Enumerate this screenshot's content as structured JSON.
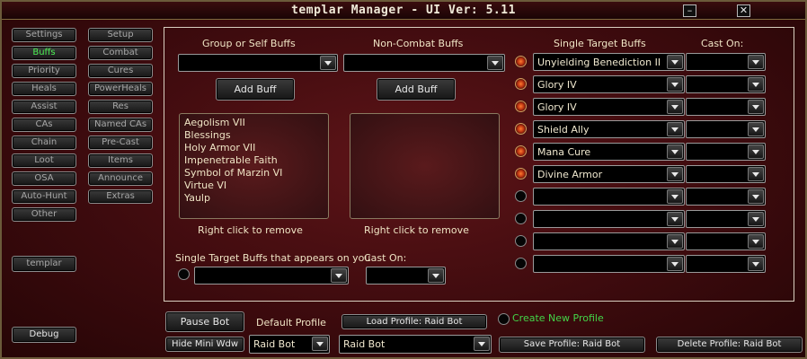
{
  "window": {
    "title": "templar Manager   - UI Ver: 5.11",
    "minimize": "–",
    "close": "✕"
  },
  "sidebar": {
    "left": [
      "Settings",
      "Buffs",
      "Priority",
      "Heals",
      "Assist",
      "CAs",
      "Chain",
      "Loot",
      "OSA",
      "Auto-Hunt",
      "Other"
    ],
    "right": [
      "Setup",
      "Combat",
      "Cures",
      "PowerHeals",
      "Res",
      "Named CAs",
      "Pre-Cast",
      "Items",
      "Announce",
      "Extras"
    ],
    "active": "Buffs",
    "profile_button": "templar",
    "debug_button": "Debug"
  },
  "group_buffs": {
    "label": "Group or Self Buffs",
    "add_button": "Add Buff",
    "items": [
      "Aegolism VII",
      "Blessings",
      "Holy Armor VII",
      "Impenetrable Faith",
      "Symbol of Marzin VI",
      "Virtue VI",
      "Yaulp"
    ],
    "remove_hint": "Right click to remove"
  },
  "noncombat_buffs": {
    "label": "Non-Combat Buffs",
    "add_button": "Add Buff",
    "items": [],
    "remove_hint": "Right click to remove"
  },
  "single_target": {
    "label": "Single Target Buffs",
    "cast_on_label": "Cast On:",
    "rows": [
      {
        "buff": "Unyielding Benediction II",
        "cast_on": "",
        "enabled": true
      },
      {
        "buff": "Glory IV",
        "cast_on": "",
        "enabled": true
      },
      {
        "buff": "Glory IV",
        "cast_on": "",
        "enabled": true
      },
      {
        "buff": "Shield Ally",
        "cast_on": "",
        "enabled": true
      },
      {
        "buff": "Mana Cure",
        "cast_on": "",
        "enabled": true
      },
      {
        "buff": "Divine Armor",
        "cast_on": "",
        "enabled": true
      },
      {
        "buff": "",
        "cast_on": "",
        "enabled": false
      },
      {
        "buff": "",
        "cast_on": "",
        "enabled": false
      },
      {
        "buff": "",
        "cast_on": "",
        "enabled": false
      },
      {
        "buff": "",
        "cast_on": "",
        "enabled": false
      }
    ]
  },
  "appears_on_you": {
    "label": "Single Target Buffs that appears on you",
    "value": "",
    "cast_on_label": "Cast On:",
    "cast_on_value": ""
  },
  "footer": {
    "pause_button": "Pause Bot",
    "hide_button": "Hide Mini Wdw",
    "default_profile_label": "Default Profile",
    "default_profile_value": "Raid Bot",
    "load_button": "Load Profile: Raid Bot",
    "profile_select_value": "Raid Bot",
    "create_label": "Create New Profile",
    "save_button": "Save Profile: Raid Bot",
    "delete_button": "Delete Profile: Raid Bot"
  },
  "colors": {
    "active_tab": "#4df054",
    "create_label": "#43d448",
    "panel_border": "#d9d0c0",
    "background": "#4a0e11"
  }
}
